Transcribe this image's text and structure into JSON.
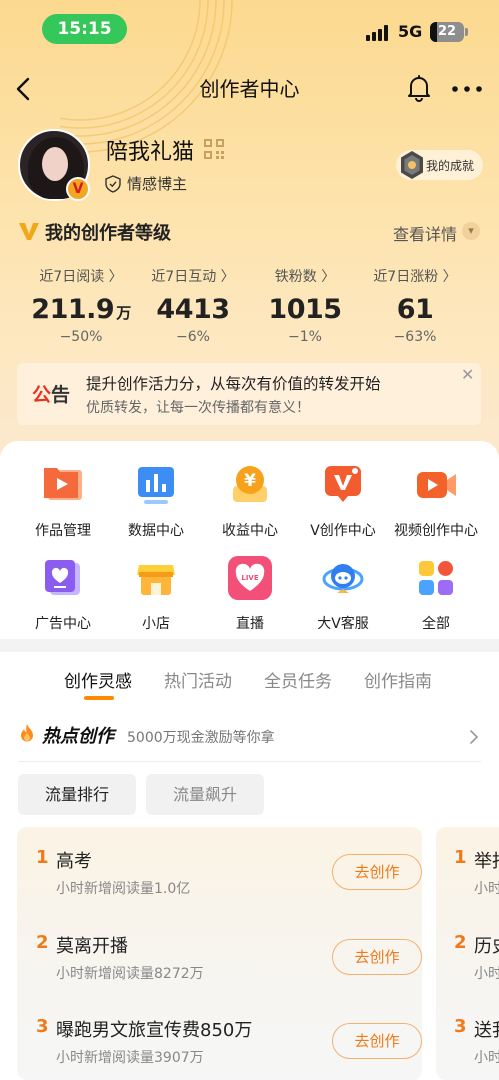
{
  "status": {
    "time": "15:15",
    "network": "5G",
    "battery": "22"
  },
  "nav": {
    "title": "创作者中心"
  },
  "profile": {
    "username": "陪我礼猫",
    "verify_label": "情感博主",
    "achievement_label": "我的成就"
  },
  "level": {
    "title": "我的创作者等级",
    "more": "查看详情"
  },
  "stats": [
    {
      "label": "近7日阅读 〉",
      "value": "211.9",
      "unit": "万",
      "change": "−50%"
    },
    {
      "label": "近7日互动 〉",
      "value": "4413",
      "unit": "",
      "change": "−6%"
    },
    {
      "label": "铁粉数 〉",
      "value": "1015",
      "unit": "",
      "change": "−1%"
    },
    {
      "label": "近7日涨粉 〉",
      "value": "61",
      "unit": "",
      "change": "−63%"
    }
  ],
  "announcement": {
    "tag_a": "公",
    "tag_b": "告",
    "title": "提升创作活力分，从每次有价值的转发开始",
    "subtitle": "优质转发，让每一次传播都有意义！",
    "close": "✕"
  },
  "tools": [
    {
      "label": "作品管理",
      "icon": "works-icon"
    },
    {
      "label": "数据中心",
      "icon": "data-icon"
    },
    {
      "label": "收益中心",
      "icon": "income-icon"
    },
    {
      "label": "V创作中心",
      "icon": "v-create-icon"
    },
    {
      "label": "视频创作中心",
      "icon": "video-create-icon"
    },
    {
      "label": "广告中心",
      "icon": "ad-icon"
    },
    {
      "label": "小店",
      "icon": "shop-icon"
    },
    {
      "label": "直播",
      "icon": "live-icon"
    },
    {
      "label": "大V客服",
      "icon": "service-icon"
    },
    {
      "label": "全部",
      "icon": "all-icon"
    }
  ],
  "tabs": [
    "创作灵感",
    "热门活动",
    "全员任务",
    "创作指南"
  ],
  "hot": {
    "title": "热点创作",
    "subtitle": "5000万现金激励等你拿"
  },
  "chips": [
    "流量排行",
    "流量飙升"
  ],
  "ranks": [
    {
      "num": "1",
      "title": "高考",
      "sub": "小时新增阅读量1.0亿",
      "button": "去创作"
    },
    {
      "num": "2",
      "title": "莫离开播",
      "sub": "小时新增阅读量8272万",
      "button": "去创作"
    },
    {
      "num": "3",
      "title": "曝跑男文旅宣传费850万",
      "sub": "小时新增阅读量3907万",
      "button": "去创作"
    }
  ],
  "ranks_next": [
    {
      "num": "1",
      "title": "举报",
      "sub": "小时新"
    },
    {
      "num": "2",
      "title": "历史",
      "sub": "小时新"
    },
    {
      "num": "3",
      "title": "送我",
      "sub": "小时新"
    }
  ],
  "colors": {
    "accent": "#f07a1a",
    "live_pink": "#f24f79",
    "tab_underline": "#ff8a00"
  }
}
